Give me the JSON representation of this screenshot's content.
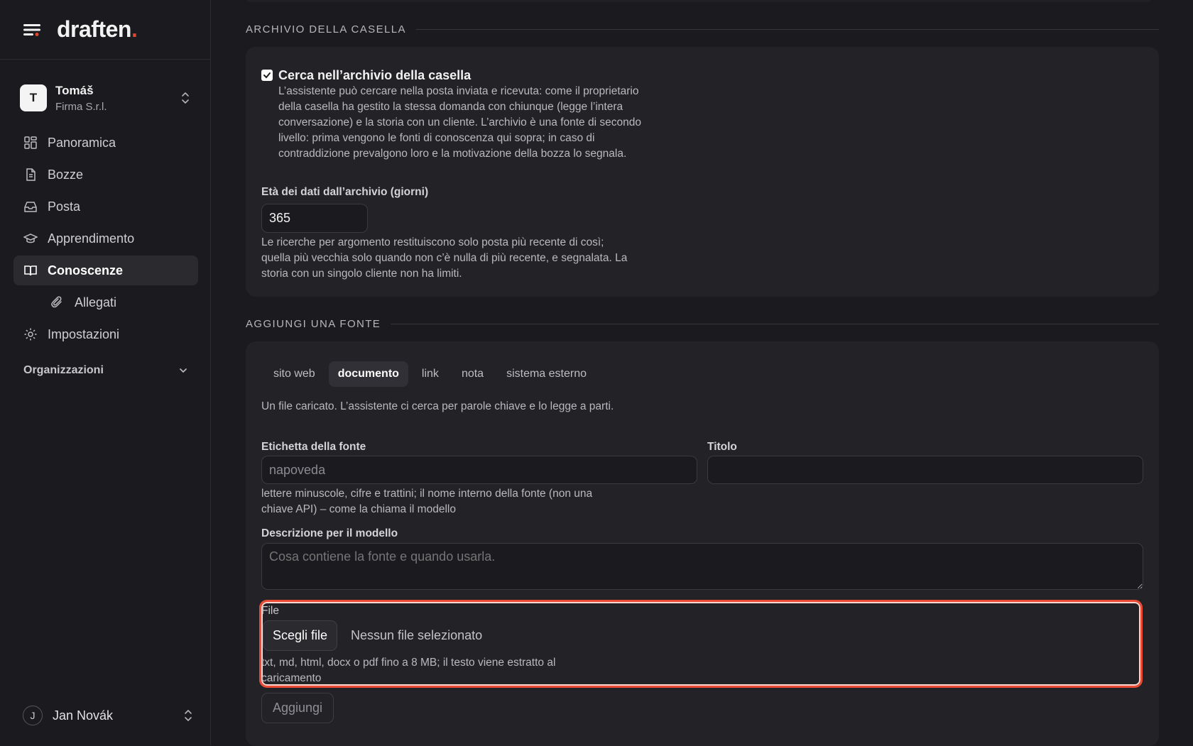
{
  "brand": {
    "name": "draften",
    "dot": "."
  },
  "org": {
    "initial": "T",
    "name": "Tomáš",
    "company": "Firma S.r.l."
  },
  "nav": {
    "items": [
      {
        "label": "Panoramica",
        "icon": "dashboard-icon"
      },
      {
        "label": "Bozze",
        "icon": "document-icon"
      },
      {
        "label": "Posta",
        "icon": "inbox-icon"
      },
      {
        "label": "Apprendimento",
        "icon": "graduation-cap-icon"
      },
      {
        "label": "Conoscenze",
        "icon": "book-icon",
        "active": true
      },
      {
        "label": "Allegati",
        "icon": "paperclip-icon",
        "sub": true
      },
      {
        "label": "Impostazioni",
        "icon": "gear-icon"
      }
    ],
    "group": "Organizzazioni"
  },
  "user": {
    "initial": "J",
    "name": "Jan Novák"
  },
  "archive": {
    "section_title": "ARCHIVIO DELLA CASELLA",
    "checkbox_label": "Cerca nell’archivio della casella",
    "checkbox_checked": true,
    "description": "L’assistente può cercare nella posta inviata e ricevuta: come il proprietario della casella ha gestito la stessa domanda con chiunque (legge l’intera conversazione) e la storia con un cliente. L’archivio è una fonte di secondo livello: prima vengono le fonti di conoscenza qui sopra; in caso di contraddizione prevalgono loro e la motivazione della bozza lo segnala.",
    "age_label": "Età dei dati dall’archivio (giorni)",
    "age_value": "365",
    "age_hint": "Le ricerche per argomento restituiscono solo posta più recente di così; quella più vecchia solo quando non c’è nulla di più recente, e segnalata. La storia con un singolo cliente non ha limiti."
  },
  "add_source": {
    "section_title": "AGGIUNGI UNA FONTE",
    "tabs": [
      {
        "label": "sito web"
      },
      {
        "label": "documento",
        "active": true
      },
      {
        "label": "link"
      },
      {
        "label": "nota"
      },
      {
        "label": "sistema esterno"
      }
    ],
    "intro": "Un file caricato. L’assistente ci cerca per parole chiave e lo legge a parti.",
    "source_label": "Etichetta della fonte",
    "source_placeholder": "napoveda",
    "title_label": "Titolo",
    "title_value": "",
    "source_hint": "lettere minuscole, cifre e trattini; il nome interno della fonte (non una chiave API) – come la chiama il modello",
    "description_label": "Descrizione per il modello",
    "description_placeholder": "Cosa contiene la fonte e quando usarla.",
    "file_label": "File",
    "file_button": "Scegli file",
    "file_status": "Nessun file selezionato",
    "file_hint": "txt, md, html, docx o pdf fino a 8 MB; il testo viene estratto al caricamento",
    "submit": "Aggiungi"
  },
  "colors": {
    "accent": "#e0452f",
    "highlight": "#ea4b35",
    "background": "#1b1b1f",
    "card": "#222227"
  }
}
